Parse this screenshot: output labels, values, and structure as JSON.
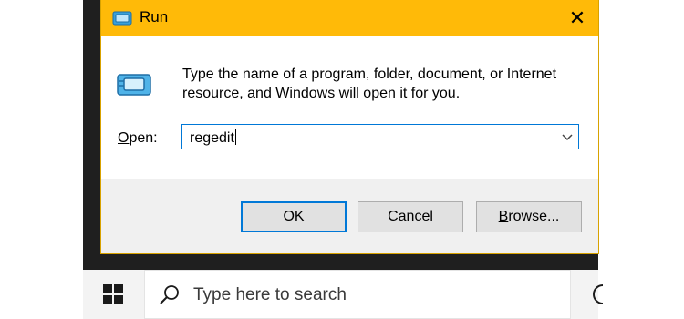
{
  "dialog": {
    "title": "Run",
    "close_glyph": "✕",
    "description": "Type the name of a program, folder, document, or Internet resource, and Windows will open it for you.",
    "open_label_accel": "O",
    "open_label_rest": "pen:",
    "open_value": "regedit",
    "buttons": {
      "ok": "OK",
      "cancel": "Cancel",
      "browse_accel": "B",
      "browse_rest": "rowse..."
    }
  },
  "taskbar": {
    "search_placeholder": "Type here to search"
  },
  "colors": {
    "title_bar": "#ffba08",
    "focus_border": "#0078d7"
  },
  "icons": [
    "run-app-icon",
    "run-program-icon",
    "close-icon",
    "chevron-down-icon",
    "windows-logo-icon",
    "search-icon",
    "task-view-icon"
  ]
}
